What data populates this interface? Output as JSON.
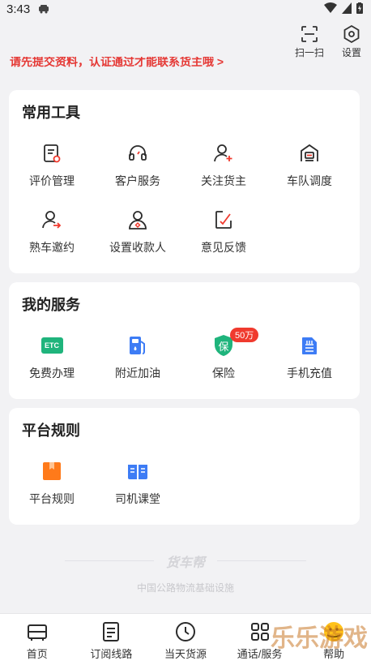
{
  "status": {
    "time": "3:43"
  },
  "top_actions": [
    {
      "label": "扫一扫",
      "icon": "scan-icon"
    },
    {
      "label": "设置",
      "icon": "settings-icon"
    }
  ],
  "notice": "请先提交资料，认证通过才能联系货主哦 >",
  "tools": {
    "title": "常用工具",
    "items": [
      {
        "label": "评价管理",
        "icon": "review-icon"
      },
      {
        "label": "客户服务",
        "icon": "headset-icon"
      },
      {
        "label": "关注货主",
        "icon": "follow-user-icon"
      },
      {
        "label": "车队调度",
        "icon": "fleet-icon"
      },
      {
        "label": "熟车邀约",
        "icon": "invite-icon"
      },
      {
        "label": "设置收款人",
        "icon": "payee-icon"
      },
      {
        "label": "意见反馈",
        "icon": "feedback-icon"
      }
    ]
  },
  "services": {
    "title": "我的服务",
    "items": [
      {
        "label": "免费办理",
        "icon": "etc-icon",
        "icon_text": "ETC"
      },
      {
        "label": "附近加油",
        "icon": "fuel-icon"
      },
      {
        "label": "保险",
        "icon": "insurance-icon",
        "icon_text": "保",
        "badge": "50万"
      },
      {
        "label": "手机充值",
        "icon": "sim-card-icon"
      }
    ]
  },
  "rules": {
    "title": "平台规则",
    "items": [
      {
        "label": "平台规则",
        "icon": "rulebook-icon"
      },
      {
        "label": "司机课堂",
        "icon": "classroom-icon"
      }
    ]
  },
  "footer": {
    "brand": "货车帮",
    "slogan": "中国公路物流基础设施"
  },
  "bottom_nav": [
    {
      "label": "首页",
      "icon": "home-truck-icon"
    },
    {
      "label": "订阅线路",
      "icon": "subscribe-icon"
    },
    {
      "label": "当天货源",
      "icon": "clock-icon"
    },
    {
      "label": "通话/服务",
      "icon": "grid-icon"
    },
    {
      "label": "帮助",
      "icon": "help-icon"
    }
  ],
  "watermark": "乐乐游戏",
  "colors": {
    "accent": "#f03a2e",
    "icon_dark": "#2b2b2b",
    "blue": "#3d7cf5",
    "green": "#1fb47c",
    "orange": "#ff7a1a"
  }
}
